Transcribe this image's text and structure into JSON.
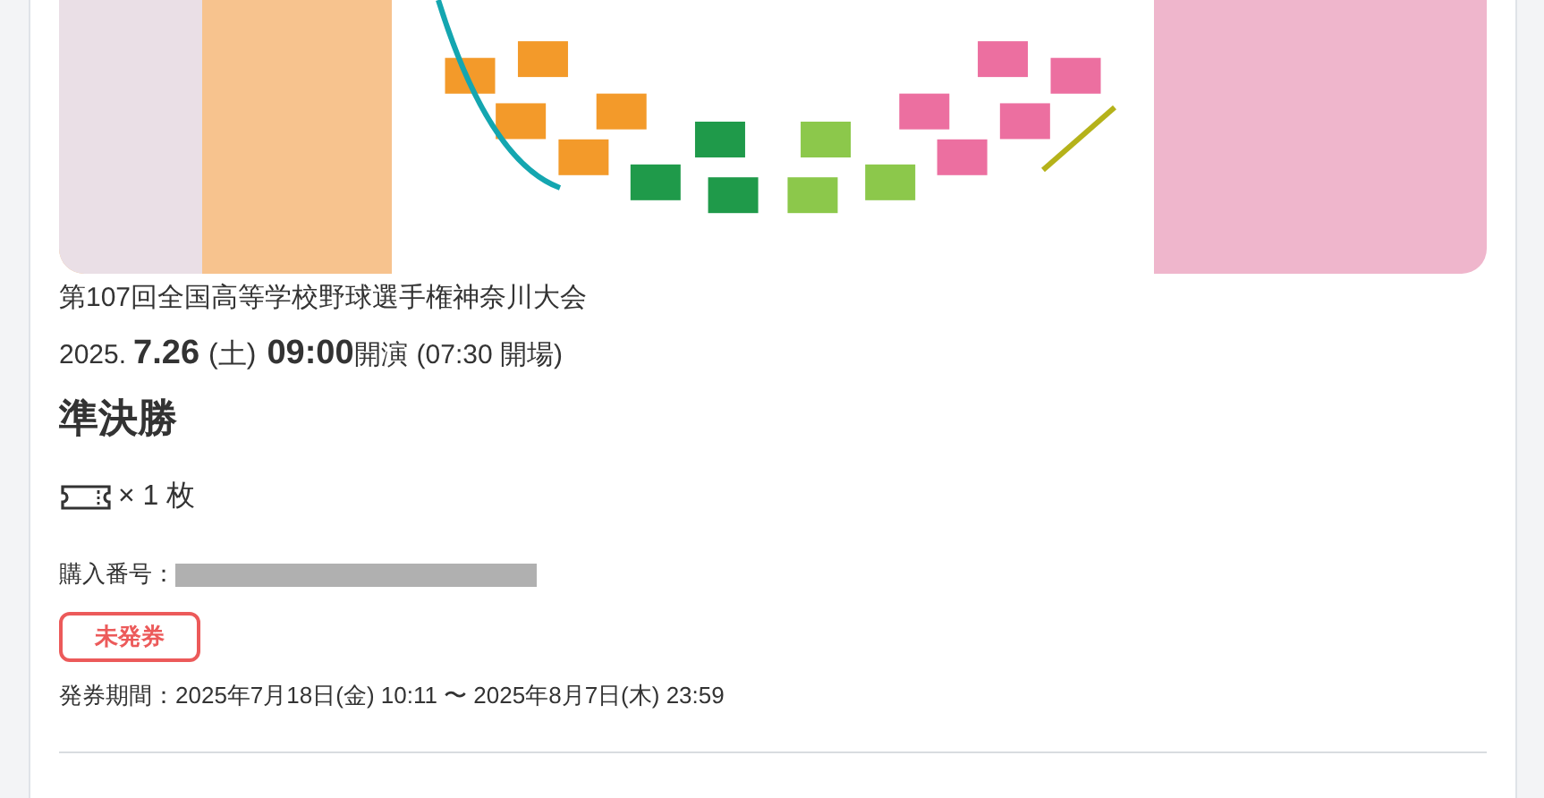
{
  "event": {
    "title": "第107回全国高等学校野球選手権神奈川大会",
    "date": {
      "year": "2025.",
      "day": "7.26",
      "weekday": "(土)",
      "time": "09:00",
      "start_label": "開演",
      "open": "(07:30 開場)"
    },
    "stage": "準決勝"
  },
  "tickets": {
    "count_text": "× 1 枚"
  },
  "purchase": {
    "label": "購入番号：",
    "redacted": true
  },
  "status_badge": {
    "text": "未発券"
  },
  "issue_period": "発券期間：2025年7月18日(金) 10:11 〜 2025年8月7日(木) 23:59"
}
